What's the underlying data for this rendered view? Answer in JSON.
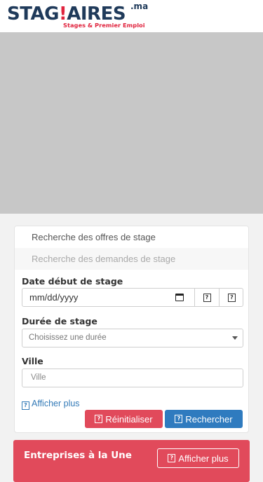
{
  "header": {
    "logo_text_part1": "STAG",
    "logo_text_part2": "AIRES",
    "logo_domain": ".ma",
    "logo_tagline": "Stages & Premier Emploi"
  },
  "search": {
    "tab_offers": "Recherche des offres de stage",
    "tab_demands": "Recherche des demandes de stage",
    "date_label": "Date début de stage",
    "date_placeholder": "mm/dd/yyyy",
    "duration_label": "Durée de stage",
    "duration_selected": "Choisissez une durée",
    "city_label": "Ville",
    "city_placeholder": "Ville",
    "more_link": "Afficher plus",
    "reset_label": "Réinitialiser",
    "search_label": "Rechercher",
    "icon_glyph": "?"
  },
  "featured": {
    "title": "Entreprises à la Une",
    "button_label": "Afficher plus"
  },
  "colors": {
    "brand_navy": "#1f3a5a",
    "brand_red": "#e0243e",
    "reset_button": "#e14a5b",
    "search_button": "#2f7bbf",
    "link": "#337ab7"
  },
  "icons": [
    "calendar-icon",
    "help-icon",
    "caret-down-icon"
  ]
}
